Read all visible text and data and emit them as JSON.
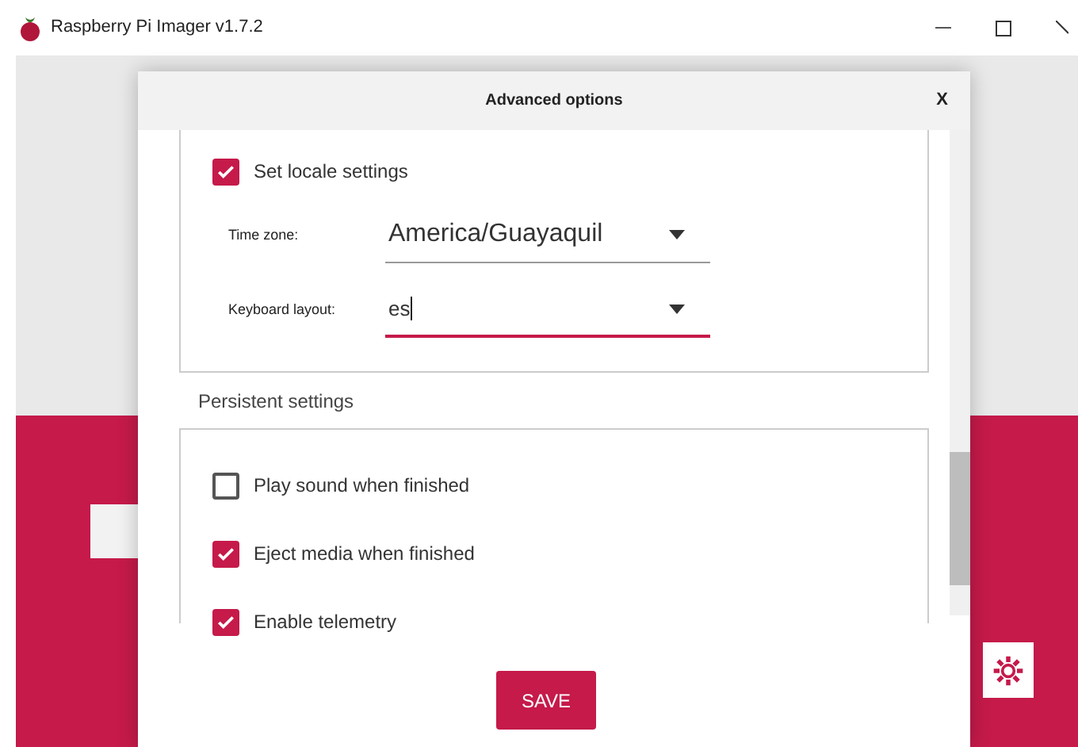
{
  "window": {
    "title": "Raspberry Pi Imager v1.7.2"
  },
  "dialog": {
    "title": "Advanced options",
    "close": "X",
    "locale": {
      "label": "Set locale settings",
      "checked": true,
      "fields": [
        {
          "label": "Time zone:",
          "value": "America/Guayaquil",
          "focused": false
        },
        {
          "label": "Keyboard layout:",
          "value": "es",
          "focused": true
        }
      ]
    },
    "persistent": {
      "title": "Persistent settings",
      "options": [
        {
          "label": "Play sound when finished",
          "checked": false
        },
        {
          "label": "Eject media when finished",
          "checked": true
        },
        {
          "label": "Enable telemetry",
          "checked": true
        }
      ]
    },
    "save": "SAVE"
  }
}
